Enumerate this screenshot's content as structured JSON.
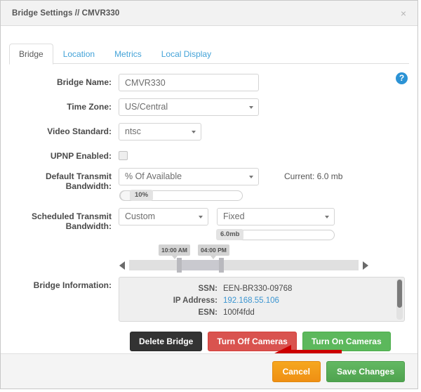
{
  "window": {
    "title": "Bridge Settings // CMVR330",
    "close_label": "×"
  },
  "tabs": [
    {
      "label": "Bridge",
      "active": true
    },
    {
      "label": "Location",
      "active": false
    },
    {
      "label": "Metrics",
      "active": false
    },
    {
      "label": "Local Display",
      "active": false
    }
  ],
  "help": {
    "glyph": "?"
  },
  "form": {
    "bridge_name": {
      "label": "Bridge Name:",
      "value": "CMVR330",
      "placeholder": ""
    },
    "time_zone": {
      "label": "Time Zone:",
      "value": "US/Central"
    },
    "video_standard": {
      "label": "Video Standard:",
      "value": "ntsc"
    },
    "upnp": {
      "label": "UPNP Enabled:",
      "checked": false
    },
    "default_transmit_bandwidth": {
      "label": "Default Transmit Bandwidth:",
      "mode": "% Of Available",
      "current_note": "Current: 6.0 mb",
      "percent": "10%"
    },
    "scheduled_transmit_bandwidth": {
      "label": "Scheduled Transmit Bandwidth:",
      "schedule": "Custom",
      "rate_mode": "Fixed",
      "rate_value": "6.0mb",
      "time_start": "10:00 AM",
      "time_end": "04:00 PM"
    },
    "bridge_information": {
      "label": "Bridge Information:",
      "rows": [
        {
          "key": "SSN:",
          "value": "EEN-BR330-09768",
          "is_link": false
        },
        {
          "key": "IP Address:",
          "value": "192.168.55.106",
          "is_link": true
        },
        {
          "key": "ESN:",
          "value": "100f4fdd",
          "is_link": false
        }
      ]
    }
  },
  "actions": {
    "delete_bridge": "Delete Bridge",
    "turn_off_cameras": "Turn Off Cameras",
    "turn_on_cameras": "Turn On Cameras"
  },
  "footer": {
    "cancel": "Cancel",
    "save": "Save Changes"
  },
  "colors": {
    "link": "#3b95d1",
    "tab_active": "#5b5b5b",
    "tab_inactive": "#44a3d8",
    "delete": "#333333",
    "danger": "#d9534f",
    "success": "#5cb85c",
    "warning": "#f0a01e",
    "save": "#5aa95a",
    "help": "#2c93d5",
    "annotation_arrow": "#cc0000"
  }
}
